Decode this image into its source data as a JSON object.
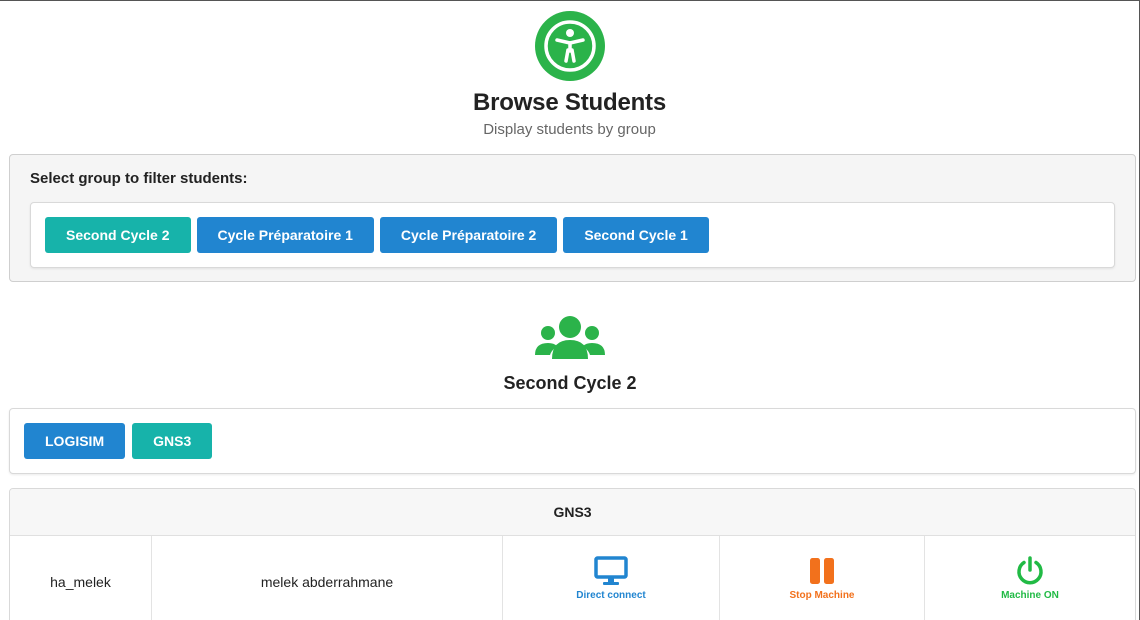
{
  "header": {
    "icon": "accessibility-icon",
    "title": "Browse Students",
    "subtitle": "Display students by group"
  },
  "filter": {
    "label": "Select group to filter students:",
    "groups": [
      {
        "label": "Second Cycle 2",
        "active": true
      },
      {
        "label": "Cycle Préparatoire 1",
        "active": false
      },
      {
        "label": "Cycle Préparatoire 2",
        "active": false
      },
      {
        "label": "Second Cycle 1",
        "active": false
      }
    ]
  },
  "group": {
    "icon": "users-icon",
    "title": "Second Cycle 2"
  },
  "software": {
    "buttons": [
      {
        "label": "LOGISIM",
        "active": false
      },
      {
        "label": "GNS3",
        "active": true
      }
    ]
  },
  "table": {
    "header": "GNS3",
    "rows": [
      {
        "username": "ha_melek",
        "full_name": "melek abderrahmane",
        "actions": [
          {
            "icon": "monitor-icon",
            "label": "Direct connect",
            "color": "#2185d0"
          },
          {
            "icon": "pause-icon",
            "label": "Stop Machine",
            "color": "#f2711c"
          },
          {
            "icon": "power-icon",
            "label": "Machine ON",
            "color": "#21ba45"
          }
        ]
      }
    ]
  },
  "colors": {
    "teal": "#17b3aa",
    "blue": "#2185d0",
    "green": "#2bb34a",
    "orange": "#f2711c"
  }
}
